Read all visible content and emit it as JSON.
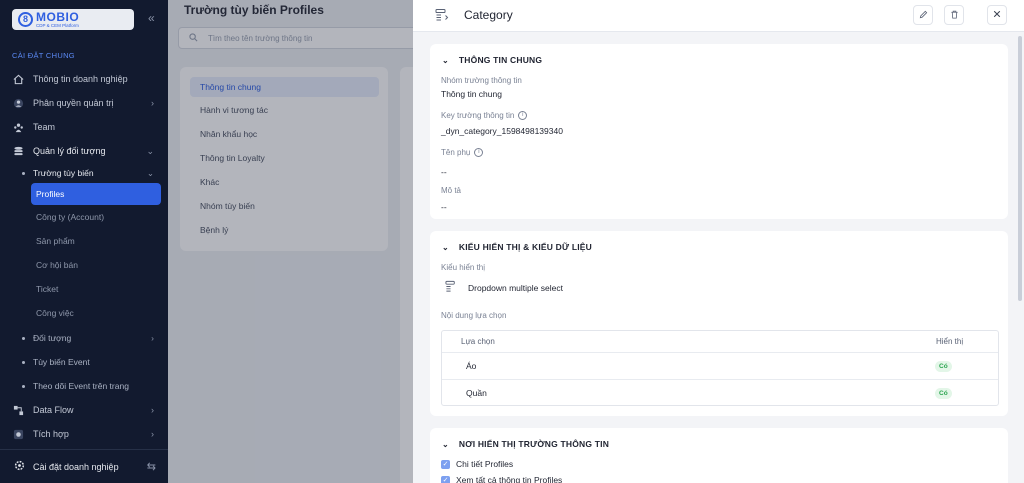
{
  "brand": {
    "logo_letter": "8",
    "name": "MOBIO",
    "tagline": "CDP & CEM Platform"
  },
  "sidebar": {
    "section_label": "CÀI ĐẶT CHUNG",
    "items": [
      {
        "label": "Thông tin doanh nghiệp",
        "icon": "home-icon"
      },
      {
        "label": "Phân quyền quản trị",
        "icon": "user-lock-icon"
      },
      {
        "label": "Team",
        "icon": "team-icon"
      },
      {
        "label": "Quản lý đối tượng",
        "icon": "database-icon"
      }
    ],
    "sub_custom_fields": "Trường tùy biến",
    "leaves": [
      "Profiles",
      "Công ty (Account)",
      "Sản phẩm",
      "Cơ hội bán",
      "Ticket",
      "Công việc"
    ],
    "sub_items": [
      "Đối tượng",
      "Tùy biến Event",
      "Theo dõi Event trên trang"
    ],
    "bottom_items": [
      {
        "label": "Data Flow",
        "icon": "data-flow-icon"
      },
      {
        "label": "Tích hợp",
        "icon": "integration-icon"
      }
    ],
    "footer_label": "Cài đặt doanh nghiệp"
  },
  "page": {
    "title": "Trường tùy biến Profiles",
    "search_placeholder": "Tìm theo tên trường thông tin",
    "groups": [
      "Thông tin chung",
      "Hành vi tương tác",
      "Nhân khẩu học",
      "Thông tin Loyalty",
      "Khác",
      "Nhóm tùy biến",
      "Bệnh lý"
    ]
  },
  "drawer": {
    "title": "Category",
    "general": {
      "heading": "THÔNG TIN CHUNG",
      "group_label": "Nhóm trường thông tin",
      "group_value": "Thông tin chung",
      "key_label": "Key trường thông tin",
      "key_value": "_dyn_category_1598498139340",
      "alias_label": "Tên phụ",
      "alias_value": "--",
      "desc_label": "Mô tả",
      "desc_value": "--"
    },
    "display": {
      "heading": "KIỂU HIỂN THỊ & KIỂU DỮ LIỆU",
      "display_label": "Kiểu hiển thị",
      "display_value": "Dropdown multiple select",
      "options_label": "Nội dung lựa chọn",
      "col_option": "Lựa chọn",
      "col_visible": "Hiển thị",
      "options": [
        {
          "label": "Áo",
          "visible": "Có"
        },
        {
          "label": "Quần",
          "visible": "Có"
        }
      ]
    },
    "placement": {
      "heading": "NƠI HIỂN THỊ TRƯỜNG THÔNG TIN",
      "checks": [
        "Chi tiết Profiles",
        "Xem tất cả thông tin Profiles"
      ]
    }
  },
  "colors": {
    "accent": "#2f5fe0",
    "sidebar_bg": "#121a2f",
    "success": "#2aa44f"
  }
}
